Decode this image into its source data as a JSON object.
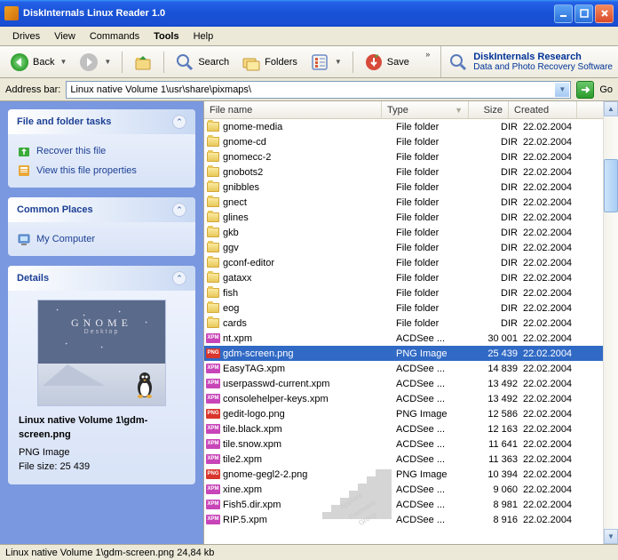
{
  "window": {
    "title": "DiskInternals Linux Reader 1.0"
  },
  "menu": {
    "items": [
      "Drives",
      "View",
      "Commands",
      "Tools",
      "Help"
    ],
    "bold_index": 3
  },
  "toolbar": {
    "back": "Back",
    "search": "Search",
    "folders": "Folders",
    "save": "Save"
  },
  "promo": {
    "title": "DiskInternals Research",
    "subtitle": "Data and Photo Recovery Software"
  },
  "address": {
    "label": "Address bar:",
    "value": "Linux native Volume 1\\usr\\share\\pixmaps\\",
    "go": "Go"
  },
  "sidebar": {
    "tasks": {
      "title": "File and folder tasks",
      "links": [
        {
          "icon": "recover",
          "label": "Recover this file"
        },
        {
          "icon": "props",
          "label": "View this file properties"
        }
      ]
    },
    "places": {
      "title": "Common Places",
      "links": [
        {
          "icon": "computer",
          "label": "My Computer"
        }
      ]
    },
    "details": {
      "title": "Details",
      "preview": {
        "title": "GNOME",
        "subtitle": "Desktop"
      },
      "name": "Linux native Volume 1\\gdm-screen.png",
      "type": "PNG Image",
      "size_label": "File size: 25 439"
    }
  },
  "filelist": {
    "columns": {
      "name": "File name",
      "type": "Type",
      "size": "Size",
      "created": "Created"
    },
    "rows": [
      {
        "icon": "folder",
        "name": "gnome-media",
        "type": "File folder",
        "size": "DIR",
        "created": "22.02.2004"
      },
      {
        "icon": "folder",
        "name": "gnome-cd",
        "type": "File folder",
        "size": "DIR",
        "created": "22.02.2004"
      },
      {
        "icon": "folder",
        "name": "gnomecc-2",
        "type": "File folder",
        "size": "DIR",
        "created": "22.02.2004"
      },
      {
        "icon": "folder",
        "name": "gnobots2",
        "type": "File folder",
        "size": "DIR",
        "created": "22.02.2004"
      },
      {
        "icon": "folder",
        "name": "gnibbles",
        "type": "File folder",
        "size": "DIR",
        "created": "22.02.2004"
      },
      {
        "icon": "folder",
        "name": "gnect",
        "type": "File folder",
        "size": "DIR",
        "created": "22.02.2004"
      },
      {
        "icon": "folder",
        "name": "glines",
        "type": "File folder",
        "size": "DIR",
        "created": "22.02.2004"
      },
      {
        "icon": "folder",
        "name": "gkb",
        "type": "File folder",
        "size": "DIR",
        "created": "22.02.2004"
      },
      {
        "icon": "folder",
        "name": "ggv",
        "type": "File folder",
        "size": "DIR",
        "created": "22.02.2004"
      },
      {
        "icon": "folder",
        "name": "gconf-editor",
        "type": "File folder",
        "size": "DIR",
        "created": "22.02.2004"
      },
      {
        "icon": "folder",
        "name": "gataxx",
        "type": "File folder",
        "size": "DIR",
        "created": "22.02.2004"
      },
      {
        "icon": "folder",
        "name": "fish",
        "type": "File folder",
        "size": "DIR",
        "created": "22.02.2004"
      },
      {
        "icon": "folder",
        "name": "eog",
        "type": "File folder",
        "size": "DIR",
        "created": "22.02.2004"
      },
      {
        "icon": "folder",
        "name": "cards",
        "type": "File folder",
        "size": "DIR",
        "created": "22.02.2004"
      },
      {
        "icon": "xpm",
        "name": "nt.xpm",
        "type": "ACDSee ...",
        "size": "30 001",
        "created": "22.02.2004"
      },
      {
        "icon": "png",
        "name": "gdm-screen.png",
        "type": "PNG Image",
        "size": "25 439",
        "created": "22.02.2004",
        "selected": true
      },
      {
        "icon": "xpm",
        "name": "EasyTAG.xpm",
        "type": "ACDSee ...",
        "size": "14 839",
        "created": "22.02.2004"
      },
      {
        "icon": "xpm",
        "name": "userpasswd-current.xpm",
        "type": "ACDSee ...",
        "size": "13 492",
        "created": "22.02.2004"
      },
      {
        "icon": "xpm",
        "name": "consolehelper-keys.xpm",
        "type": "ACDSee ...",
        "size": "13 492",
        "created": "22.02.2004"
      },
      {
        "icon": "png",
        "name": "gedit-logo.png",
        "type": "PNG Image",
        "size": "12 586",
        "created": "22.02.2004"
      },
      {
        "icon": "xpm",
        "name": "tile.black.xpm",
        "type": "ACDSee ...",
        "size": "12 163",
        "created": "22.02.2004"
      },
      {
        "icon": "xpm",
        "name": "tile.snow.xpm",
        "type": "ACDSee ...",
        "size": "11 641",
        "created": "22.02.2004"
      },
      {
        "icon": "xpm",
        "name": "tile2.xpm",
        "type": "ACDSee ...",
        "size": "11 363",
        "created": "22.02.2004"
      },
      {
        "icon": "png",
        "name": "gnome-gegl2-2.png",
        "type": "PNG Image",
        "size": "10 394",
        "created": "22.02.2004"
      },
      {
        "icon": "xpm",
        "name": "xine.xpm",
        "type": "ACDSee ...",
        "size": "9 060",
        "created": "22.02.2004"
      },
      {
        "icon": "xpm",
        "name": "Fish5.dir.xpm",
        "type": "ACDSee ...",
        "size": "8 981",
        "created": "22.02.2004"
      },
      {
        "icon": "xpm",
        "name": "RIP.5.xpm",
        "type": "ACDSee ...",
        "size": "8 916",
        "created": "22.02.2004"
      }
    ]
  },
  "statusbar": {
    "text": "Linux native Volume 1\\gdm-screen.png 24,84 kb"
  }
}
